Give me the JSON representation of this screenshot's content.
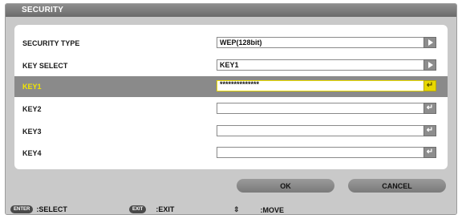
{
  "title": "SECURITY",
  "rows": [
    {
      "label": "SECURITY TYPE",
      "value": "WEP(128bit)",
      "button": "arrow"
    },
    {
      "label": "KEY SELECT",
      "value": "KEY1",
      "button": "arrow"
    },
    {
      "label": "KEY1",
      "value": "**************",
      "button": "enter",
      "selected": true
    },
    {
      "label": "KEY2",
      "value": "",
      "button": "enter"
    },
    {
      "label": "KEY3",
      "value": "",
      "button": "enter"
    },
    {
      "label": "KEY4",
      "value": "",
      "button": "enter"
    }
  ],
  "buttons": {
    "ok": "OK",
    "cancel": "CANCEL"
  },
  "footer": {
    "enter_key": "ENTER",
    "select": ":SELECT",
    "exit_key": "EXIT",
    "exit": ":EXIT",
    "move_icon": "up-down-icon",
    "move": ":MOVE"
  },
  "colors": {
    "highlight_text": "#f2e600",
    "highlight_row": "#8a8a8a",
    "active_button": "#e8d800"
  }
}
